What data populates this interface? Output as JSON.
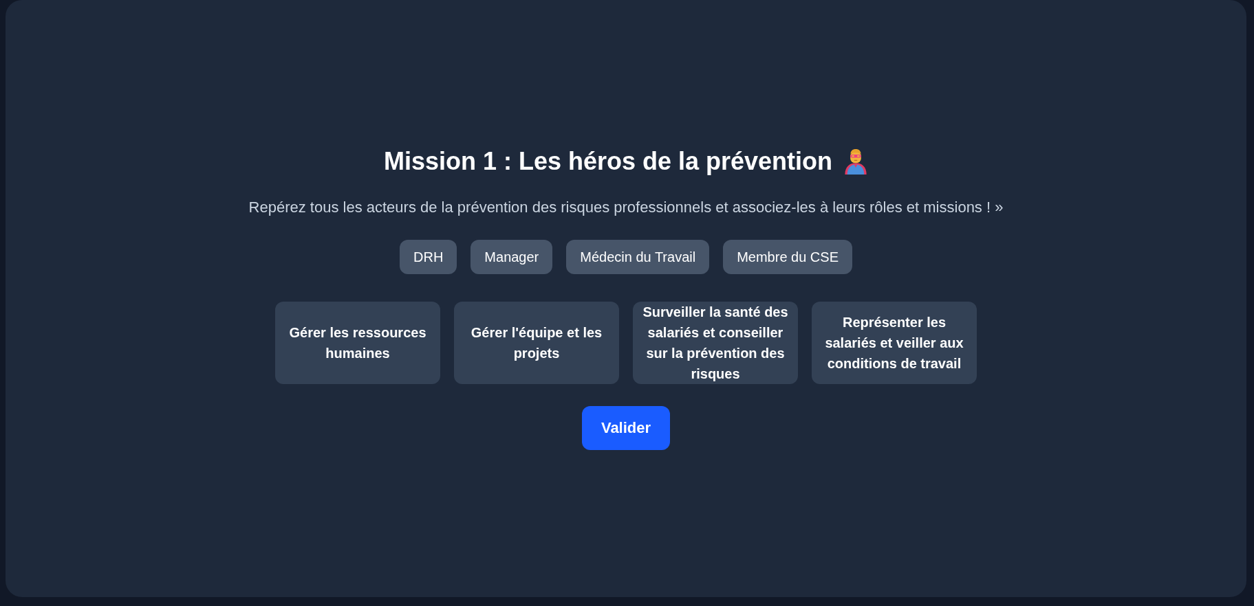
{
  "title": "Mission 1 : Les héros de la prévention",
  "subtitle": "Repérez tous les acteurs de la prévention des risques professionnels et associez-les à leurs rôles et missions ! »",
  "actors": [
    "DRH",
    "Manager",
    "Médecin du Travail",
    "Membre du CSE"
  ],
  "missions": [
    "Gérer les ressources humaines",
    "Gérer l'équipe et les projets",
    "Surveiller la santé des salariés et conseiller sur la prévention des risques",
    "Représenter les salariés et veiller aux conditions de travail"
  ],
  "submit_button": "Valider"
}
